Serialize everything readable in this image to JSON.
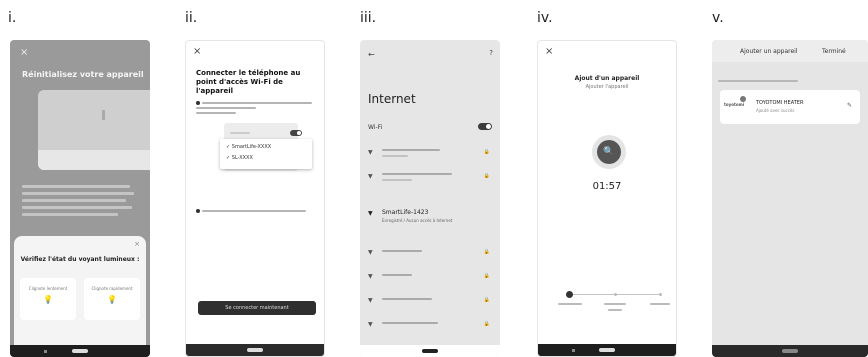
{
  "labels": [
    "i.",
    "ii.",
    "iii.",
    "iv.",
    "v."
  ],
  "phone1": {
    "close": "×",
    "title": "Réinitialisez votre appareil",
    "sheet_close": "×",
    "sheet_title": "Vérifiez l'état du voyant lumineux :",
    "option_left": "Clignote lentement",
    "option_right": "Clignote rapidement",
    "option_icon": "💡"
  },
  "phone2": {
    "close": "×",
    "title": "Connecter le téléphone au point d'accès Wi-Fi de l'appareil",
    "popup_item1": "✓ SmartLife-XXXX",
    "popup_item2": "✓ SL-XXXX",
    "button": "Se connecter maintenant"
  },
  "phone3": {
    "back": "←",
    "help": "?",
    "title": "Internet",
    "wifi_label": "Wi-Fi",
    "selected_network": "SmartLife-1423",
    "selected_sub": "Enregistré / Aucun accès à Internet",
    "wifi_icon": "▼",
    "lock_icon": "🔒"
  },
  "phone4": {
    "close": "×",
    "title": "Ajout d'un appareil",
    "subtitle": "Ajouter l'appareil",
    "search_icon": "🔍",
    "timer": "01:57"
  },
  "phone5": {
    "title": "Ajouter un appareil",
    "right_action": "Terminé",
    "logo_text": "toyotomi",
    "device_name": "TOYOTOMI HEATER",
    "device_status": "Ajouté avec succès",
    "edit_icon": "✎"
  }
}
